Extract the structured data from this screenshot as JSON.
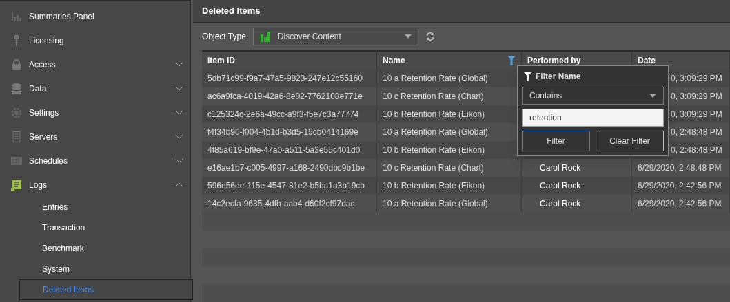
{
  "sidebar": {
    "items": [
      {
        "label": "Summaries Panel"
      },
      {
        "label": "Licensing"
      },
      {
        "label": "Access",
        "expanded": false
      },
      {
        "label": "Data",
        "expanded": false
      },
      {
        "label": "Settings",
        "expanded": false
      },
      {
        "label": "Servers",
        "expanded": false
      },
      {
        "label": "Schedules",
        "expanded": false
      },
      {
        "label": "Logs",
        "expanded": true,
        "children": [
          {
            "label": "Entries",
            "selected": false
          },
          {
            "label": "Transaction",
            "selected": false
          },
          {
            "label": "Benchmark",
            "selected": false
          },
          {
            "label": "System",
            "selected": false
          },
          {
            "label": "Deleted Items",
            "selected": true
          }
        ]
      }
    ]
  },
  "header": {
    "title": "Deleted Items"
  },
  "toolbar": {
    "label": "Object Type",
    "dropdown": {
      "value": "Discover Content"
    }
  },
  "table": {
    "columns": [
      {
        "label": "Item ID",
        "filtered": false
      },
      {
        "label": "Name",
        "filtered": true
      },
      {
        "label": "Performed by",
        "filtered": false
      },
      {
        "label": "Date",
        "filtered": false
      }
    ],
    "rows": [
      [
        "5db71c99-f9a7-47a5-9823-247e12c55160",
        "10 a Retention Rate (Global)",
        "",
        "0, 3:09:29 PM"
      ],
      [
        "ac6a9fca-4019-42a6-8e02-7762108e771e",
        "10 c Retention Rate (Chart)",
        "",
        "0, 3:09:29 PM"
      ],
      [
        "c125324c-2e6a-49cc-a9f3-f5e7c3a77774",
        "10 b Retention Rate (Eikon)",
        "",
        "0, 3:09:29 PM"
      ],
      [
        "f4f34b90-f004-4b1d-b3d5-15cb0414169e",
        "10 a Retention Rate (Global)",
        "",
        "0, 2:48:48 PM"
      ],
      [
        "4f85a619-bf9e-47a0-a511-5a3e55c401d0",
        "10 b Retention Rate (Eikon)",
        "",
        "0, 2:48:48 PM"
      ],
      [
        "e16ae1b7-c005-4997-a168-2490dbc9b1be",
        "10 c Retention Rate (Chart)",
        "Carol Rock",
        "6/29/2020, 2:48:48 PM"
      ],
      [
        "596e56de-115e-4547-81e2-b5ba1a3b19cb",
        "10 b Retention Rate (Eikon)",
        "Carol Rock",
        "6/29/2020, 2:42:56 PM"
      ],
      [
        "14c2ecfa-9635-4dfb-aab4-d60f2cf97dac",
        "10 a Retention Rate (Global)",
        "Carol Rock",
        "6/29/2020, 2:42:56 PM"
      ]
    ]
  },
  "filter_popup": {
    "title": "Filter Name",
    "operator": "Contains",
    "value": "retention",
    "buttons": [
      {
        "label": "Filter",
        "focused": true
      },
      {
        "label": "Clear Filter",
        "focused": false
      }
    ]
  }
}
